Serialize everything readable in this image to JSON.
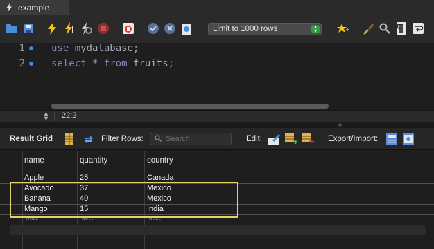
{
  "tab": {
    "title": "example",
    "icon": "lightning-icon"
  },
  "toolbar": {
    "limit_select": "Limit to 1000 rows",
    "icons": [
      "open-folder-icon",
      "save-icon",
      "execute-icon",
      "execute-cursor-icon",
      "explain-icon",
      "stop-icon",
      "toggle-error-icon",
      "commit-icon",
      "rollback-icon",
      "autocommit-icon",
      "beautify-icon",
      "brush-icon",
      "find-icon",
      "invisible-chars-icon",
      "wrap-icon"
    ]
  },
  "editor": {
    "lines": [
      {
        "number": "1",
        "text": "use mydatabase;"
      },
      {
        "number": "2",
        "text": "select * from fruits;"
      }
    ]
  },
  "status": {
    "position": "22:2"
  },
  "result_toolbar": {
    "title": "Result Grid",
    "filter_label": "Filter Rows:",
    "search_placeholder": "Search",
    "edit_label": "Edit:",
    "export_label": "Export/Import:"
  },
  "grid": {
    "columns": [
      "name",
      "quantity",
      "country"
    ],
    "rows": [
      [
        "Apple",
        "25",
        "Canada"
      ],
      [
        "Avocado",
        "37",
        "Mexico"
      ],
      [
        "Banana",
        "40",
        "Mexico"
      ],
      [
        "Mango",
        "15",
        "India"
      ]
    ],
    "null_row": [
      "NULL",
      "NULL",
      "NULL"
    ],
    "highlight_color": "#e2d36a"
  }
}
